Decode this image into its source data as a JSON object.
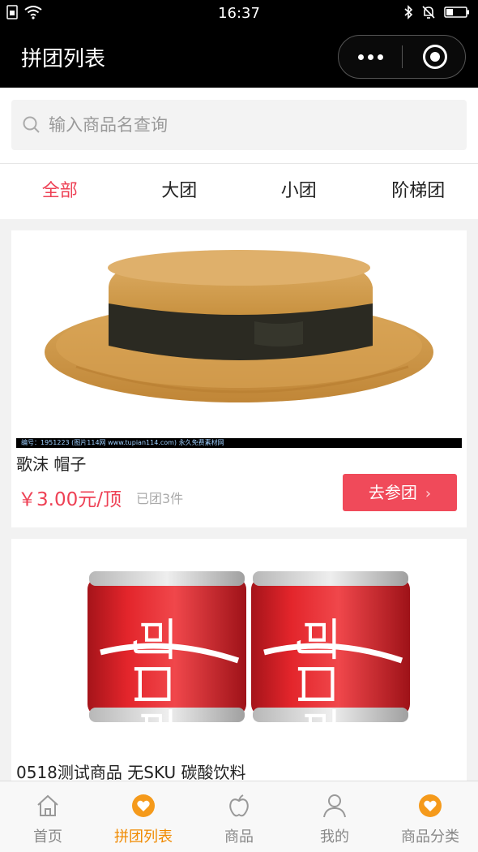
{
  "status_bar": {
    "time": "16:37"
  },
  "nav": {
    "title": "拼团列表"
  },
  "search": {
    "placeholder": "输入商品名查询"
  },
  "tabs": [
    "全部",
    "大团",
    "小团",
    "阶梯团"
  ],
  "products": [
    {
      "name": "歌沫 帽子",
      "price": "￥3.00元/顶",
      "sold": "已团3件",
      "button": "去参团",
      "watermark": "编号：1951223 (图片114网 www.tupian114.com)   永久免费素材网"
    },
    {
      "name": "0518测试商品 无SKU 碳酸饮料",
      "can_text": "可口可乐"
    }
  ],
  "tabbar": [
    {
      "label": "首页",
      "icon": "home-icon"
    },
    {
      "label": "拼团列表",
      "icon": "heart-badge-icon"
    },
    {
      "label": "商品",
      "icon": "apple-icon"
    },
    {
      "label": "我的",
      "icon": "user-icon"
    },
    {
      "label": "商品分类",
      "icon": "heart-badge-icon"
    }
  ],
  "colors": {
    "accent": "#ee4155",
    "button": "#f04a5a",
    "tab_active": "#f08a00"
  }
}
